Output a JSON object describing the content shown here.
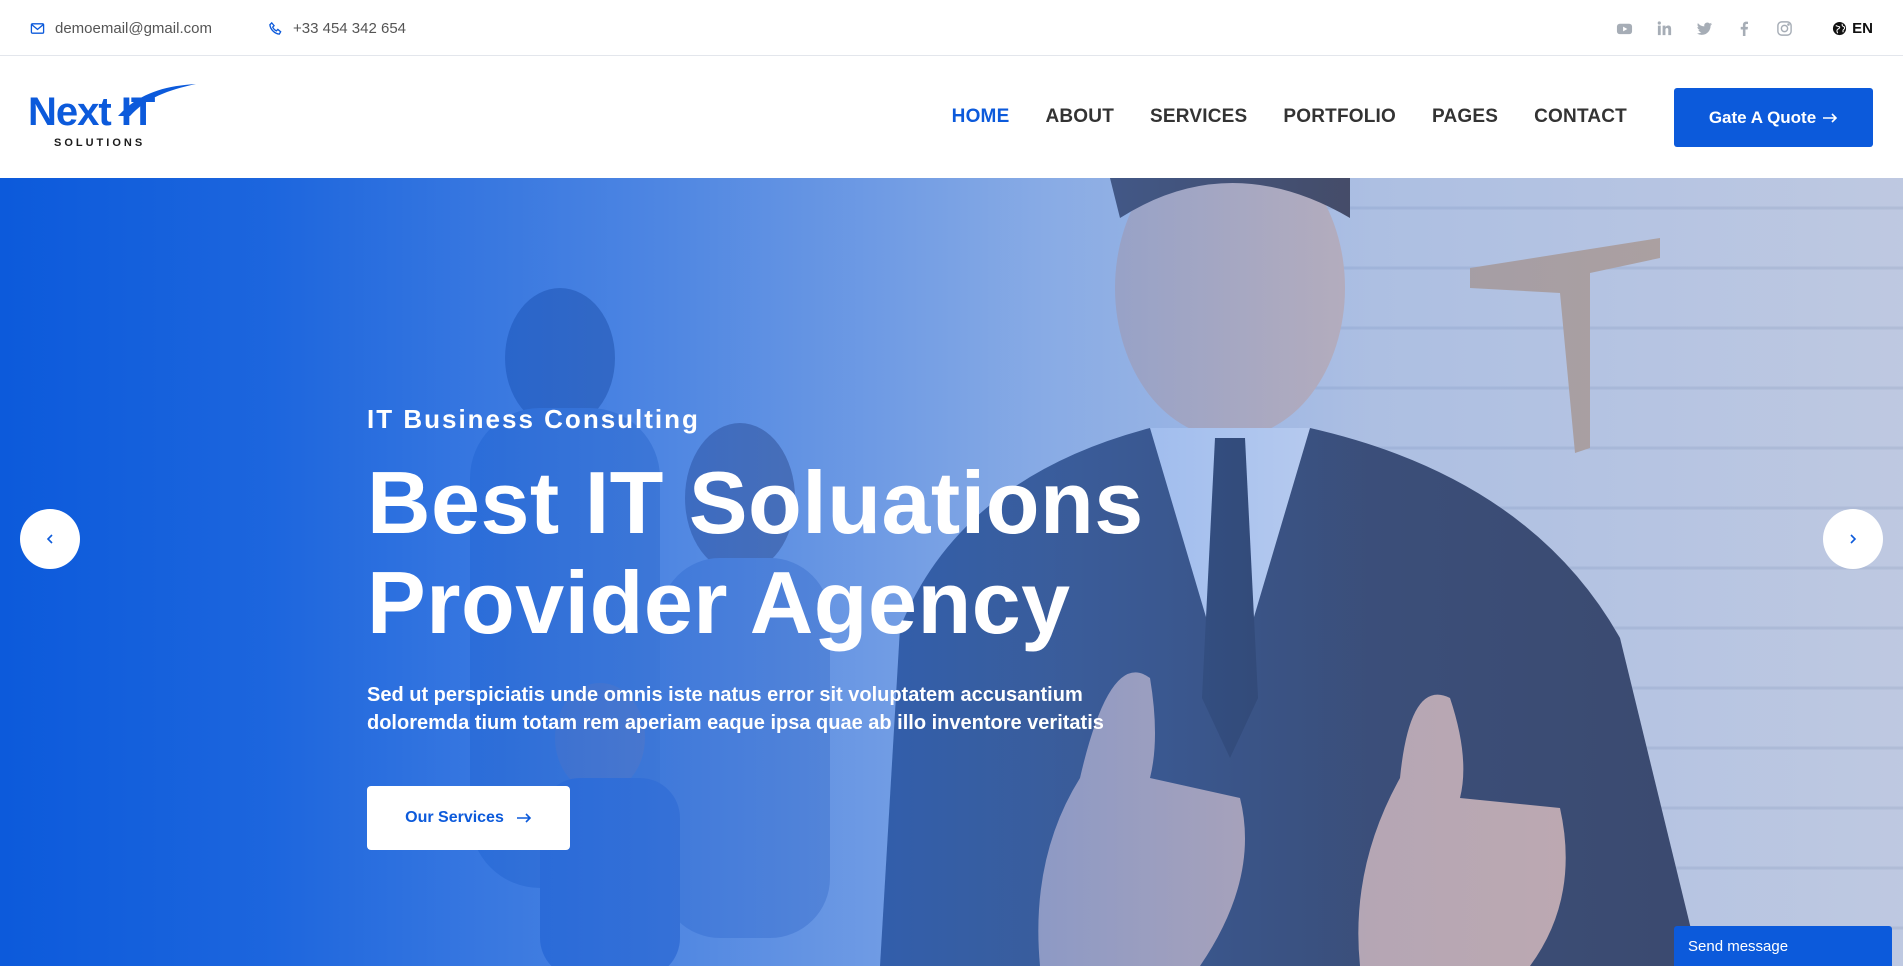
{
  "topbar": {
    "email": "demoemail@gmail.com",
    "phone": "+33 454 342 654",
    "socials": [
      "youtube-icon",
      "linkedin-icon",
      "twitter-icon",
      "facebook-icon",
      "instagram-icon"
    ],
    "language": "EN"
  },
  "header": {
    "logo_word": "Next IT",
    "logo_sub": "SOLUTIONS",
    "nav": {
      "home": "HOME",
      "about": "ABOUT",
      "services": "SERVICES",
      "portfolio": "PORTFOLIO",
      "pages": "PAGES",
      "contact": "CONTACT"
    },
    "quote_label": "Gate A Quote"
  },
  "hero": {
    "eyebrow": "IT Business Consulting",
    "title_line1": "Best IT Soluations",
    "title_line2": "Provider Agency",
    "desc_line1": "Sed ut perspiciatis unde omnis iste natus error sit voluptatem accusantium",
    "desc_line2": "doloremda tium totam rem aperiam eaque ipsa quae ab illo inventore veritatis",
    "button_label": "Our Services"
  },
  "chat": {
    "label": "Send message"
  },
  "colors": {
    "brand": "#0c5adb",
    "text": "#333333",
    "muted_icon": "#a6adb6"
  }
}
